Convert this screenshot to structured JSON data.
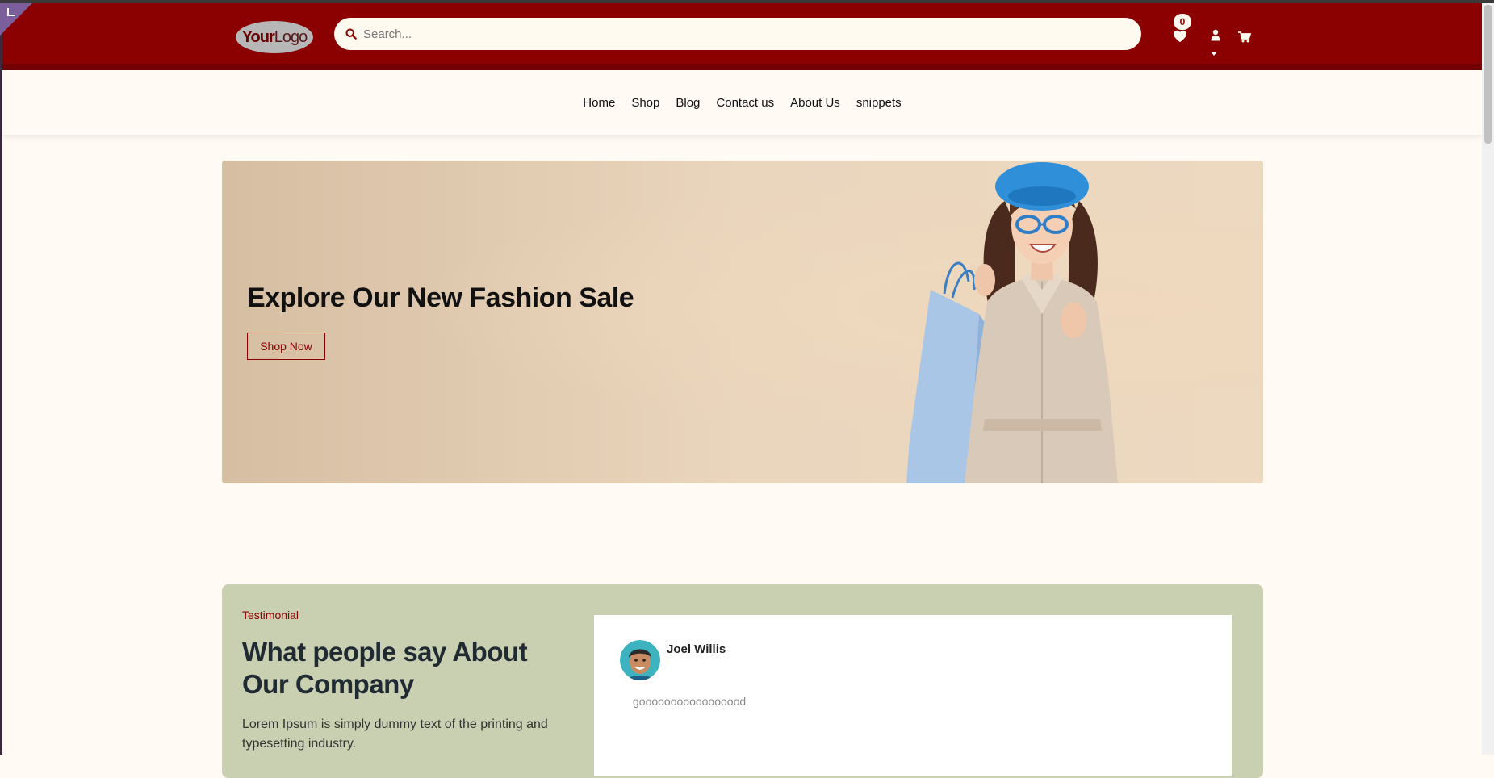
{
  "header": {
    "logo_text_bold": "Your",
    "logo_text_light": "Logo",
    "search_placeholder": "Search...",
    "wishlist_count": "0",
    "icons": [
      "search-icon",
      "heart-icon",
      "user-icon",
      "cart-icon"
    ]
  },
  "nav": {
    "items": [
      {
        "label": "Home"
      },
      {
        "label": "Shop"
      },
      {
        "label": "Blog"
      },
      {
        "label": "Contact us"
      },
      {
        "label": "About Us"
      },
      {
        "label": "snippets"
      }
    ]
  },
  "hero": {
    "title": "Explore Our New Fashion Sale",
    "button_label": "Shop Now"
  },
  "testimonial": {
    "eyebrow": "Testimonial",
    "heading": "What people say About Our Company",
    "description": "Lorem Ipsum is simply dummy text of the printing and typesetting industry.",
    "reviewer_name": "Joel Willis",
    "quote": "gooooooooooooooood"
  },
  "colors": {
    "brand": "#8b0000",
    "page_bg": "#fffaf3",
    "testimonial_bg": "#c9cfb1"
  }
}
